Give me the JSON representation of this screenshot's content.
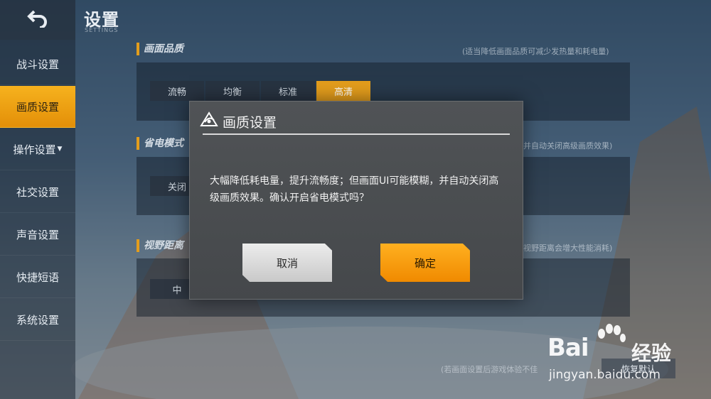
{
  "header": {
    "title": "设置",
    "subtitle": "SETTINGS",
    "back_icon": "back-arrow-icon"
  },
  "sidebar": {
    "items": [
      {
        "label": "战斗设置",
        "active": false
      },
      {
        "label": "画质设置",
        "active": true
      },
      {
        "label": "操作设置",
        "active": false,
        "has_caret": true
      },
      {
        "label": "社交设置",
        "active": false
      },
      {
        "label": "声音设置",
        "active": false
      },
      {
        "label": "快捷短语",
        "active": false
      },
      {
        "label": "系统设置",
        "active": false
      }
    ]
  },
  "sections": {
    "quality": {
      "title": "画面品质",
      "note": "(适当降低画面品质可减少发热量和耗电量)",
      "options": [
        "流畅",
        "均衡",
        "标准",
        "高清"
      ],
      "selected": "高清"
    },
    "power_saving": {
      "title": "省电模式",
      "note": "并自动关闭高级画质效果)",
      "value": "关闭"
    },
    "view_distance": {
      "title": "视野距离",
      "note": "视野距离会增大性能消耗)",
      "value": "中"
    },
    "bottom": {
      "note": "(若画面设置后游戏体验不佳",
      "button_label": "恢复默认"
    }
  },
  "dialog": {
    "title": "画质设置",
    "logo_icon": "game-logo-icon",
    "message": "大幅降低耗电量，提升流畅度；但画面UI可能模糊，并自动关闭高级画质效果。确认开启省电模式吗？",
    "cancel_label": "取消",
    "confirm_label": "确定"
  },
  "watermark": {
    "brand": "Bai",
    "brand_suffix": "经验",
    "url": "jingyan.baidu.com"
  },
  "colors": {
    "accent": "#f08a00",
    "dialog_bg": "#4b4e51",
    "sidebar_active": "#f6b21e"
  }
}
